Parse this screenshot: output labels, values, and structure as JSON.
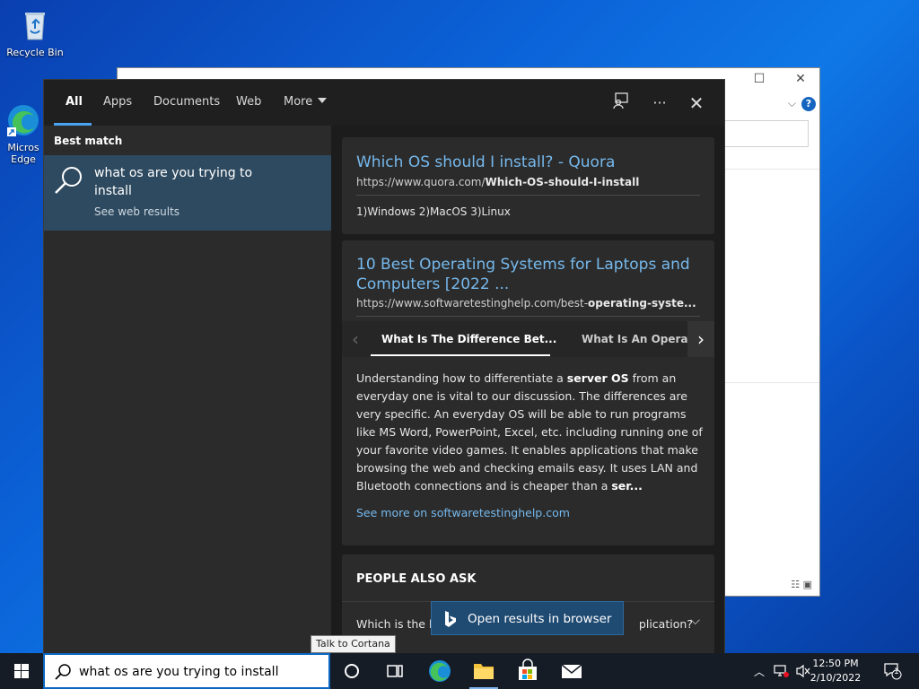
{
  "desktop": {
    "recycle_bin": "Recycle Bin",
    "edge_label_1": "Micros",
    "edge_label_2": "Edge"
  },
  "search_panel": {
    "tabs": [
      "All",
      "Apps",
      "Documents",
      "Web",
      "More"
    ],
    "best_match_label": "Best match",
    "best_match": {
      "query_line1": "what os are you trying to",
      "query_line2": "install",
      "sub": "See web results"
    },
    "results": [
      {
        "title": "Which OS should I install? - Quora",
        "url_prefix": "https://www.quora.com/",
        "url_bold": "Which-OS-should-I-install",
        "snippet": "1)Windows 2)MacOS 3)Linux"
      },
      {
        "title_line1": "10 Best Operating Systems for Laptops and",
        "title_line2": "Computers [2022 ...",
        "url_prefix": "https://www.softwaretestinghelp.com/best-",
        "url_bold": "operating-syste...",
        "carousel_tabs": [
          "What Is The Difference Bet...",
          "What Is An Opera"
        ],
        "body": {
          "p1": "Understanding how to differentiate a ",
          "b1": "server OS",
          "p2": " from an everyday one is vital to our discussion. The differences are very specific. An everyday OS will be able to run programs like MS Word, PowerPoint, Excel, etc. including running one of your favorite video games. It enables applications that make browsing the web and checking emails easy. It uses LAN and Bluetooth connections and is cheaper than a ",
          "b2": "ser...",
          "more": "See more on softwaretestinghelp.com"
        }
      }
    ],
    "people_also_ask": {
      "title": "PEOPLE ALSO ASK",
      "q_start": "Which is the b",
      "q_end": "plication?"
    },
    "open_browser": "Open results in browser"
  },
  "tooltip": "Talk to Cortana",
  "taskbar": {
    "search_query": "what os are you trying to install",
    "time": "12:50 PM",
    "date": "2/10/2022",
    "notification_count": "1"
  },
  "colors": {
    "accent": "#4aa3f0",
    "link": "#76b9ed",
    "selected_item": "#2e4a60",
    "panel_bg": "#202020"
  }
}
